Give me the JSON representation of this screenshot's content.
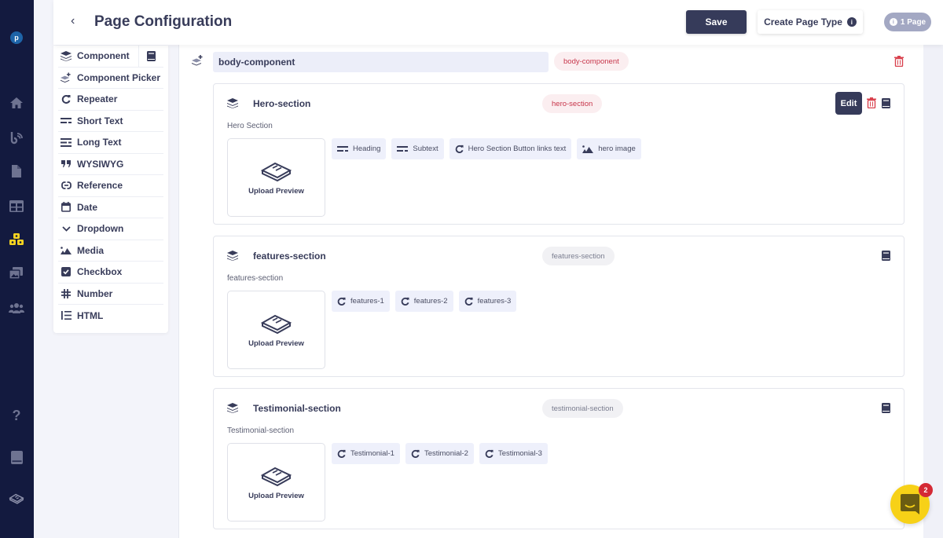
{
  "app": {
    "user_initial": "p",
    "accent_color": "#363b5a",
    "rail_color": "#131a3f",
    "active_rail_color": "#f5d321"
  },
  "rail": {
    "items": [
      {
        "name": "home",
        "active": false
      },
      {
        "name": "activity",
        "active": false
      },
      {
        "name": "pages",
        "active": false
      },
      {
        "name": "layout",
        "active": false
      },
      {
        "name": "components",
        "active": true
      },
      {
        "name": "media",
        "active": false
      },
      {
        "name": "users",
        "active": false
      }
    ],
    "bottom": [
      {
        "name": "help"
      },
      {
        "name": "docs"
      },
      {
        "name": "logo"
      }
    ]
  },
  "header": {
    "back_label": "‹",
    "title": "Page Configuration",
    "save_label": "Save",
    "create_label": "Create Page Type",
    "page_count_label": "1 Page"
  },
  "fields": [
    {
      "label": "Component",
      "icon": "layers"
    },
    {
      "label": "Component Picker",
      "icon": "layers-plus"
    },
    {
      "label": "Repeater",
      "icon": "repeat"
    },
    {
      "label": "Short Text",
      "icon": "short-text"
    },
    {
      "label": "Long Text",
      "icon": "long-text"
    },
    {
      "label": "WYSIWYG",
      "icon": "quote"
    },
    {
      "label": "Reference",
      "icon": "link"
    },
    {
      "label": "Date",
      "icon": "calendar"
    },
    {
      "label": "Dropdown",
      "icon": "chevron-down"
    },
    {
      "label": "Media",
      "icon": "image"
    },
    {
      "label": "Checkbox",
      "icon": "checkbox"
    },
    {
      "label": "Number",
      "icon": "hash"
    },
    {
      "label": "HTML",
      "icon": "list"
    }
  ],
  "body": {
    "name_value": "body-component",
    "tag": "body-component"
  },
  "sections": [
    {
      "name": "Hero-section",
      "tag": "hero-section",
      "tag_style": "red",
      "description": "Hero Section",
      "preview_label": "Upload Preview",
      "edit_label": "Edit",
      "chips": [
        {
          "label": "Heading",
          "icon": "short-text"
        },
        {
          "label": "Subtext",
          "icon": "short-text"
        },
        {
          "label": "Hero Section Button links text",
          "icon": "repeat"
        },
        {
          "label": "hero image",
          "icon": "image"
        }
      ]
    },
    {
      "name": "features-section",
      "tag": "features-section",
      "tag_style": "gray",
      "description": "features-section",
      "preview_label": "Upload Preview",
      "chips": [
        {
          "label": "features-1",
          "icon": "repeat"
        },
        {
          "label": "features-2",
          "icon": "repeat"
        },
        {
          "label": "features-3",
          "icon": "repeat"
        }
      ]
    },
    {
      "name": "Testimonial-section",
      "tag": "testimonial-section",
      "tag_style": "gray",
      "description": "Testimonial-section",
      "preview_label": "Upload Preview",
      "chips": [
        {
          "label": "Testimonial-1",
          "icon": "repeat"
        },
        {
          "label": "Testimonial-2",
          "icon": "repeat"
        },
        {
          "label": "Testimonial-3",
          "icon": "repeat"
        }
      ]
    }
  ],
  "chat": {
    "unread_count": "2"
  }
}
